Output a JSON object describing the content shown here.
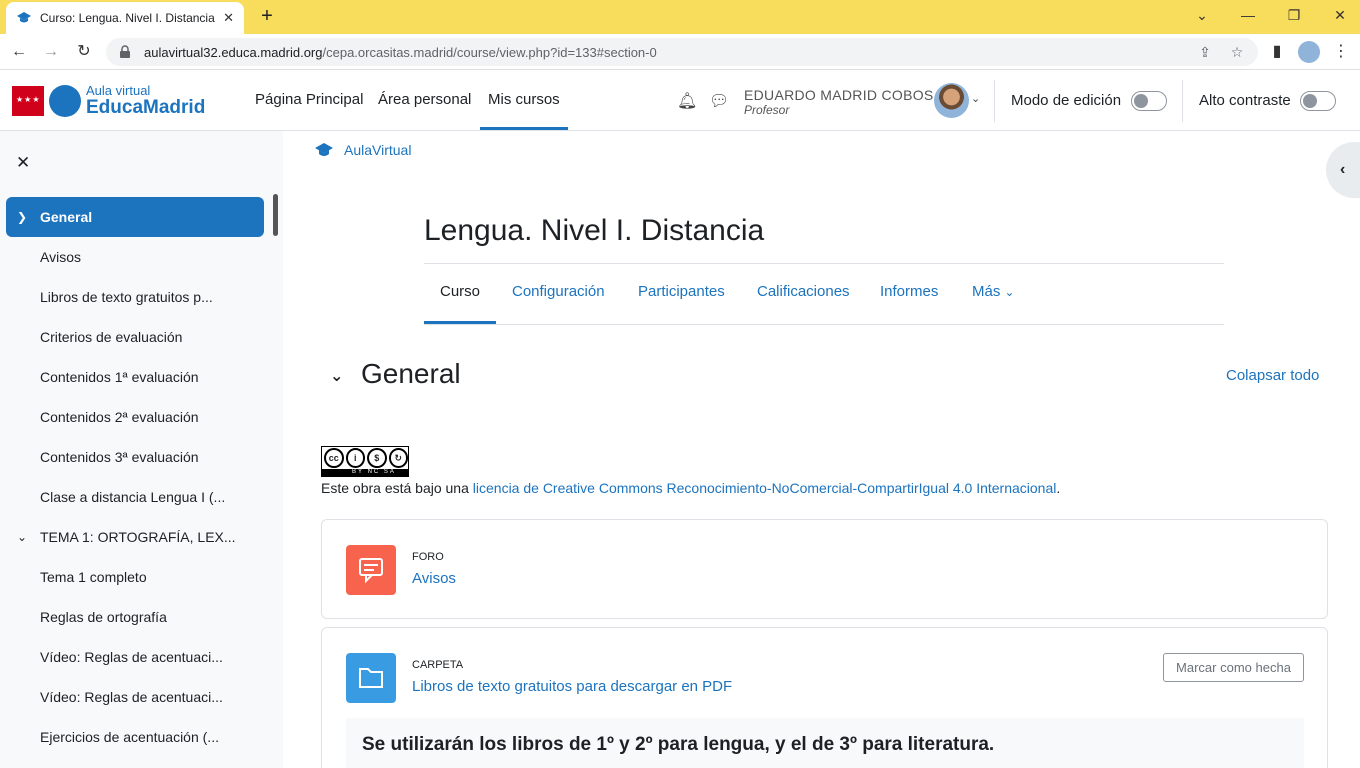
{
  "browser": {
    "tab_title": "Curso: Lengua. Nivel I. Distancia",
    "tab_close": "✕",
    "new_tab": "+",
    "url_host": "aulavirtual32.educa.madrid.org",
    "url_path": "/cepa.orcasitas.madrid/course/view.php?id=133#section-0"
  },
  "header": {
    "logo_line1": "Aula virtual",
    "logo_line2": "EducaMadrid",
    "nav": [
      "Página Principal",
      "Área personal",
      "Mis cursos"
    ],
    "user_name": "EDUARDO MADRID COBOS",
    "user_role": "Profesor",
    "edit_mode_label": "Modo de edición",
    "edit_mode_on": false,
    "high_contrast_label": "Alto contraste",
    "high_contrast_on": false
  },
  "drawer": {
    "close": "✕",
    "items": [
      {
        "label": "General",
        "type": "section",
        "active": true
      },
      {
        "label": "Avisos",
        "type": "item"
      },
      {
        "label": "Libros de texto gratuitos p...",
        "type": "item"
      },
      {
        "label": "Criterios de evaluación",
        "type": "item"
      },
      {
        "label": "Contenidos 1ª evaluación",
        "type": "item"
      },
      {
        "label": "Contenidos 2ª evaluación",
        "type": "item"
      },
      {
        "label": "Contenidos 3ª evaluación",
        "type": "item"
      },
      {
        "label": "Clase a distancia Lengua I (...",
        "type": "item"
      },
      {
        "label": "TEMA 1: ORTOGRAFÍA, LEX...",
        "type": "section"
      },
      {
        "label": "Tema 1 completo",
        "type": "item"
      },
      {
        "label": "Reglas de ortografía",
        "type": "item"
      },
      {
        "label": "Vídeo: Reglas de acentuaci...",
        "type": "item"
      },
      {
        "label": "Vídeo: Reglas de acentuaci...",
        "type": "item"
      },
      {
        "label": "Ejercicios de acentuación (...",
        "type": "item"
      }
    ]
  },
  "main": {
    "breadcrumb": "AulaVirtual",
    "course_title": "Lengua. Nivel I. Distancia",
    "tabs": [
      "Curso",
      "Configuración",
      "Participantes",
      "Calificaciones",
      "Informes",
      "Más"
    ],
    "section_title": "General",
    "collapse_all": "Colapsar todo",
    "cc_badge_text": "BY NC SA",
    "license_prefix": "Este obra está bajo una ",
    "license_link": "licencia de Creative Commons Reconocimiento-NoComercial-CompartirIgual 4.0 Internacional",
    "license_suffix": ".",
    "activities": [
      {
        "type": "FORO",
        "name": "Avisos",
        "icon": "forum-icon",
        "color": "#f7634d"
      },
      {
        "type": "CARPETA",
        "name": "Libros de texto gratuitos para descargar en PDF",
        "icon": "folder-icon",
        "color": "#399be2",
        "button": "Marcar como hecha",
        "description": "Se utilizarán los libros de 1º y 2º para lengua, y el de 3º para literatura."
      }
    ]
  },
  "colors": {
    "accent": "#1c73be",
    "tabbar": "#f8dc5b"
  }
}
